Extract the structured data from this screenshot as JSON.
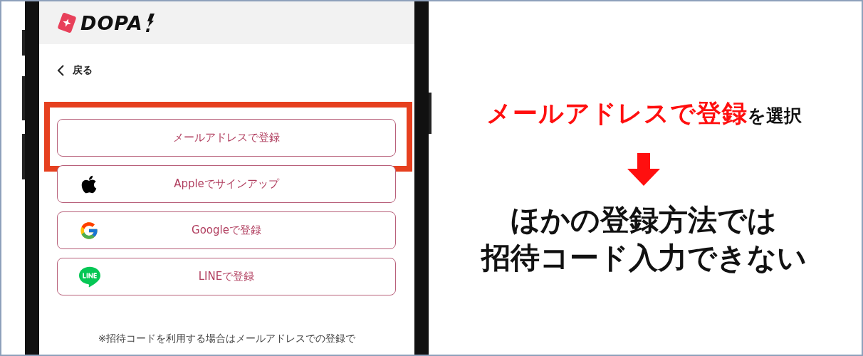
{
  "logo": {
    "text": "DOPA"
  },
  "back": {
    "label": "戻る"
  },
  "options": [
    {
      "kind": "email",
      "label": "メールアドレスで登録",
      "highlighted": true
    },
    {
      "kind": "apple",
      "label": "Appleでサインアップ",
      "highlighted": false
    },
    {
      "kind": "google",
      "label": "Googleで登録",
      "highlighted": false
    },
    {
      "kind": "line",
      "label": "LINEで登録",
      "highlighted": false
    }
  ],
  "note": "※招待コードを利用する場合はメールアドレスでの登録で",
  "annotation": {
    "heading_highlight": "メールアドレスで登録",
    "heading_rest": "を選択",
    "lines": [
      "ほかの登録方法では",
      "招待コード入力できない"
    ]
  }
}
